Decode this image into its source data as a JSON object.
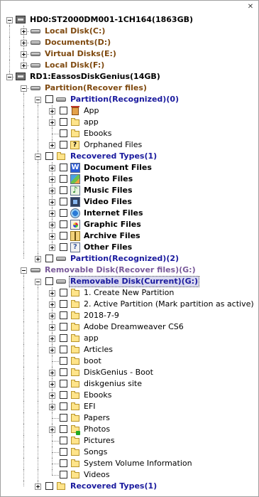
{
  "window": {
    "close_glyph": "✕"
  },
  "tree": {
    "hd0": {
      "label": "HD0:ST2000DM001-1CH164(1863GB)",
      "partitions": [
        "Local Disk(C:)",
        "Documents(D:)",
        "Virtual Disks(E:)",
        "Local Disk(F:)"
      ]
    },
    "rd1": {
      "label": "RD1:EassosDiskGenius(14GB)",
      "partition_root": "Partition(Recover files)",
      "recognized0": {
        "label": "Partition(Recognized)(0)",
        "items": [
          "App",
          "app",
          "Ebooks",
          "Orphaned Files"
        ]
      },
      "recovered_types": {
        "label": "Recovered Types(1)",
        "items": [
          "Document Files",
          "Photo Files",
          "Music Files",
          "Video Files",
          "Internet Files",
          "Graphic Files",
          "Archive Files",
          "Other Files"
        ]
      },
      "recognized2": {
        "label": "Partition(Recognized)(2)"
      }
    },
    "removable": {
      "label": "Removable Disk(Recover files)(G:)",
      "current": {
        "label": "Removable Disk(Current)(G:)",
        "items": [
          "1. Create New Partition",
          "2. Active Partition (Mark partition as active)",
          "2018-7-9",
          "Adobe Dreamweaver CS6",
          "app",
          "Articles",
          "boot",
          "DiskGenius - Boot",
          "diskgenius site",
          "Ebooks",
          "EFI",
          "Papers",
          "Photos",
          "Pictures",
          "Songs",
          "System Volume Information",
          "Videos"
        ]
      },
      "recovered_types": {
        "label": "Recovered Types(1)"
      }
    }
  },
  "icons": {
    "disk": "hard-disk-icon",
    "volume": "volume-icon",
    "folder": "folder-icon",
    "recycle": "recycle-bin-icon",
    "orphaned": "unknown-folder-icon",
    "document": "word-document-icon",
    "photo": "photo-icon",
    "music": "music-icon",
    "video": "video-icon",
    "internet": "internet-icon",
    "graphic": "graphic-icon",
    "archive": "archive-icon",
    "other": "other-file-icon"
  },
  "colors": {
    "partition_text": "#7f4a10",
    "recognized_text": "#1a1a9e",
    "removable_text": "#7a5a9a",
    "selected_bg": "#d9d9ef"
  }
}
